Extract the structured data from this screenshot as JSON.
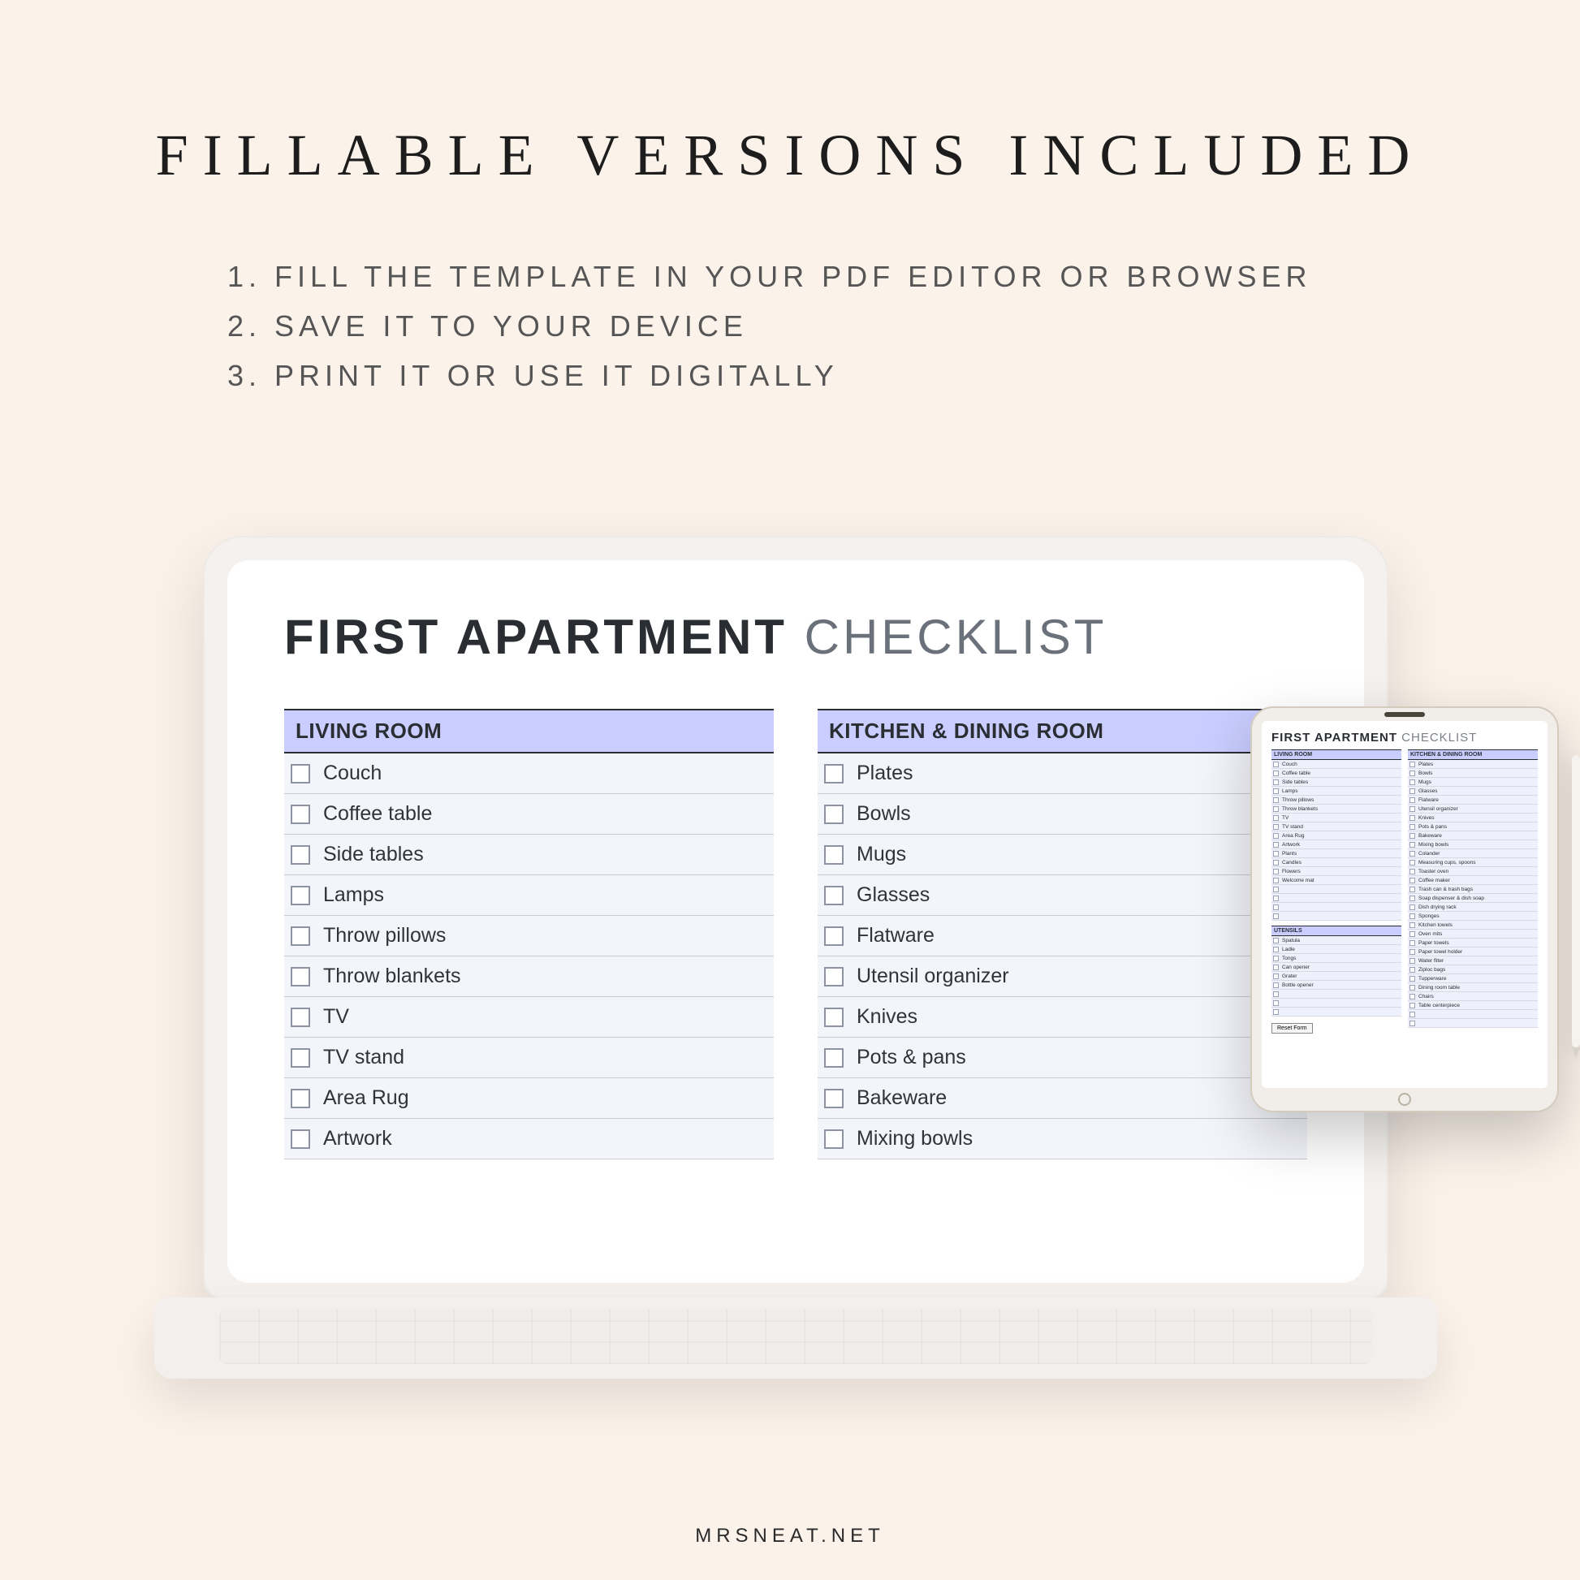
{
  "headline": "FILLABLE  VERSIONS  INCLUDED",
  "steps": [
    "1. FILL THE TEMPLATE IN YOUR PDF EDITOR OR BROWSER",
    "2. SAVE IT TO YOUR DEVICE",
    "3. PRINT IT OR USE IT DIGITALLY"
  ],
  "doc": {
    "title_bold": "FIRST APARTMENT ",
    "title_thin": "CHECKLIST",
    "living_room": {
      "header": "LIVING ROOM",
      "items": [
        "Couch",
        "Coffee table",
        "Side tables",
        "Lamps",
        "Throw pillows",
        "Throw blankets",
        "TV",
        "TV stand",
        "Area Rug",
        "Artwork"
      ]
    },
    "kitchen": {
      "header": "KITCHEN & DINING ROOM",
      "items": [
        "Plates",
        "Bowls",
        "Mugs",
        "Glasses",
        "Flatware",
        "Utensil organizer",
        "Knives",
        "Pots & pans",
        "Bakeware",
        "Mixing bowls"
      ]
    }
  },
  "tablet": {
    "title_bold": "FIRST APARTMENT ",
    "title_thin": "CHECKLIST",
    "living_room": {
      "header": "LIVING ROOM",
      "items": [
        "Couch",
        "Coffee table",
        "Side tables",
        "Lamps",
        "Throw pillows",
        "Throw blankets",
        "TV",
        "TV stand",
        "Area Rug",
        "Artwork",
        "Plants",
        "Candles",
        "Flowers",
        "Welcome mat"
      ]
    },
    "utensils": {
      "header": "UTENSILS",
      "items": [
        "Spatula",
        "Ladle",
        "Tongs",
        "Can opener",
        "Grater",
        "Bottle opener"
      ]
    },
    "kitchen": {
      "header": "KITCHEN & DINING ROOM",
      "items": [
        "Plates",
        "Bowls",
        "Mugs",
        "Glasses",
        "Flatware",
        "Utensil organizer",
        "Knives",
        "Pots & pans",
        "Bakeware",
        "Mixing bowls",
        "Colander",
        "Measuring cups, spoons",
        "Toaster oven",
        "Coffee maker",
        "Trash can & trash bags",
        "Soap dispenser & dish soap",
        "Dish drying rack",
        "Sponges",
        "Kitchen towels",
        "Oven mits",
        "Paper towels",
        "Paper towel holder",
        "Water filter",
        "Ziploc bags",
        "Tupperware",
        "Dining room table",
        "Chairs",
        "Table centerpiece"
      ]
    },
    "button": "Reset Form"
  },
  "footer": "MRSNEAT.NET"
}
